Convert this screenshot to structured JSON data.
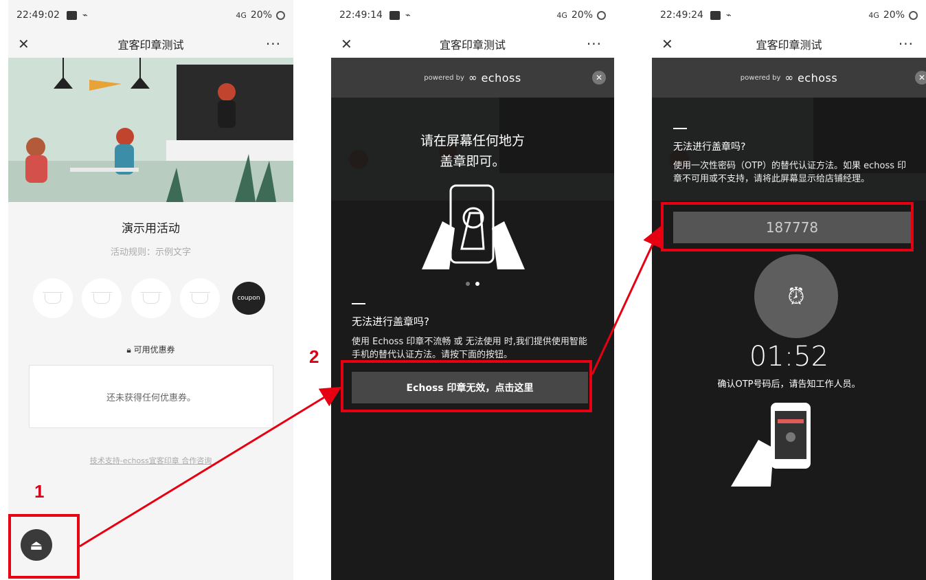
{
  "panels": [
    {
      "status": {
        "time": "22:49:02",
        "net": "4G",
        "battery": "20%"
      },
      "nav": {
        "close": "✕",
        "title": "宜客印章测试",
        "more": "···"
      },
      "campaign_title": "演示用活动",
      "rules": "活动规则：示例文字",
      "coupon_stamp": "coupon",
      "available_coupons": "可用优惠券",
      "empty_coupons": "还未获得任何优惠券。",
      "tech_support": "技术支持-echoss宜客印章 合作咨询"
    },
    {
      "status": {
        "time": "22:49:14",
        "net": "4G",
        "battery": "20%"
      },
      "nav": {
        "close": "✕",
        "title": "宜客印章测试",
        "more": "···"
      },
      "powered_by": "powered by",
      "brand": "echoss",
      "heading_line1": "请在屏幕任何地方",
      "heading_line2": "盖章即可。",
      "cannot_stamp_title": "无法进行盖章吗?",
      "cannot_stamp_body": "使用 Echoss 印章不流畅 或 无法使用 时,我们提供使用智能手机的替代认证方法。请按下面的按钮。",
      "fallback_button": "Echoss 印章无效，点击这里"
    },
    {
      "status": {
        "time": "22:49:24",
        "net": "4G",
        "battery": "20%"
      },
      "nav": {
        "close": "✕",
        "title": "宜客印章测试",
        "more": "···"
      },
      "powered_by": "powered by",
      "brand": "echoss",
      "cannot_stamp_title": "无法进行盖章吗?",
      "otp_body": "使用一次性密码（OTP）的替代认证方法。如果 echoss 印章不可用或不支持，请将此屏幕显示给店铺经理。",
      "otp_code": "187778",
      "timer": "01:52",
      "confirm_text": "确认OTP号码后，请告知工作人员。"
    }
  ],
  "annotations": {
    "step1": "1",
    "step2": "2"
  },
  "colors": {
    "highlight": "#e60012",
    "overlay": "#2b2b2b"
  }
}
